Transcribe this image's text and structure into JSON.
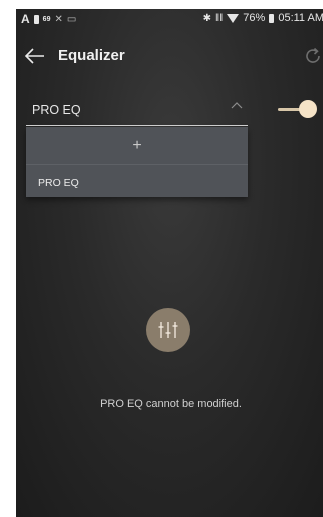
{
  "status_bar": {
    "left_letter": "A",
    "left_number": "69",
    "battery_percent": "76%",
    "time": "05:11 AM"
  },
  "header": {
    "title": "Equalizer"
  },
  "preset": {
    "selected_label": "PRO EQ",
    "toggle_on": true
  },
  "dropdown": {
    "add_label": "+",
    "items": [
      {
        "label": "PRO EQ"
      }
    ]
  },
  "message": {
    "text": "PRO EQ cannot be modified."
  },
  "icons": {
    "back": "back-arrow-icon",
    "refresh": "refresh-icon",
    "chevron": "chevron-up-icon",
    "badge": "equalizer-sliders-icon"
  },
  "colors": {
    "accent": "#f5e3c7",
    "badge": "#8a7d6b",
    "dropdown_bg": "#505358"
  }
}
